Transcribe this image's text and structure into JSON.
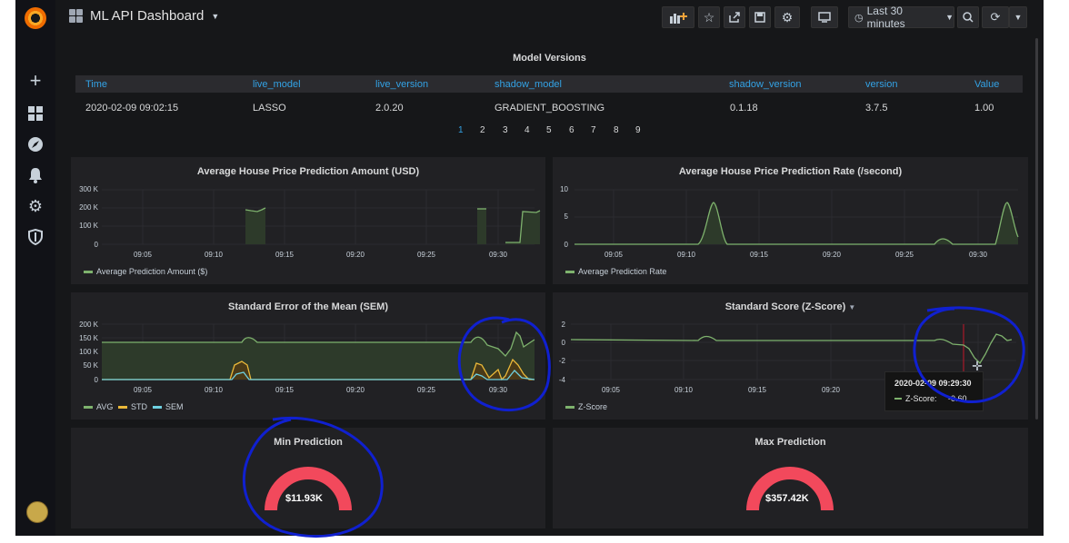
{
  "dashboard": {
    "title": "ML API Dashboard",
    "time_range": "Last 30 minutes"
  },
  "model_versions": {
    "title": "Model Versions",
    "columns": [
      "Time",
      "live_model",
      "live_version",
      "shadow_model",
      "shadow_version",
      "version",
      "Value"
    ],
    "rows": [
      [
        "2020-02-09 09:02:15",
        "LASSO",
        "2.0.20",
        "GRADIENT_BOOSTING",
        "0.1.18",
        "3.7.5",
        "1.00"
      ]
    ],
    "pages": [
      "1",
      "2",
      "3",
      "4",
      "5",
      "6",
      "7",
      "8",
      "9"
    ],
    "active_page": "1"
  },
  "x_ticks": [
    "09:05",
    "09:10",
    "09:15",
    "09:20",
    "09:25",
    "09:30"
  ],
  "chart_data": [
    {
      "type": "area",
      "title": "Average House Price Prediction Amount (USD)",
      "yticks": [
        "300 K",
        "200 K",
        "100 K",
        "0"
      ],
      "ylim": [
        0,
        300000
      ],
      "series": [
        {
          "name": "Average Prediction Amount ($)",
          "color": "#7eb26d",
          "points": [
            [
              "09:10",
              185000
            ],
            [
              "09:10:30",
              182000
            ],
            [
              "09:11",
              178000
            ],
            [
              "09:11:30",
              190000
            ],
            [
              "09:27:30",
              190000
            ],
            [
              "09:28",
              188000
            ],
            [
              "09:30",
              180000
            ],
            [
              "09:31",
              183000
            ],
            [
              "09:32",
              175000
            ],
            [
              "09:32:30",
              185000
            ]
          ]
        }
      ]
    },
    {
      "type": "area",
      "title": "Average House Price Prediction Rate (/second)",
      "yticks": [
        "10",
        "5",
        "0"
      ],
      "ylim": [
        0,
        10
      ],
      "series": [
        {
          "name": "Average Prediction Rate",
          "color": "#7eb26d",
          "points": [
            [
              "09:10",
              0
            ],
            [
              "09:11",
              3
            ],
            [
              "09:11:40",
              7.5
            ],
            [
              "09:12:30",
              2
            ],
            [
              "09:13",
              0
            ],
            [
              "09:27",
              0
            ],
            [
              "09:27:40",
              1.2
            ],
            [
              "09:28",
              1
            ],
            [
              "09:29",
              0
            ],
            [
              "09:31",
              2
            ],
            [
              "09:32",
              7.5
            ],
            [
              "09:33",
              1
            ]
          ]
        }
      ]
    },
    {
      "type": "area",
      "title": "Standard Error of the Mean (SEM)",
      "yticks": [
        "200 K",
        "150 K",
        "100 K",
        "50 K",
        "0"
      ],
      "ylim": [
        0,
        200000
      ],
      "series": [
        {
          "name": "AVG",
          "color": "#7eb26d"
        },
        {
          "name": "STD",
          "color": "#eab839"
        },
        {
          "name": "SEM",
          "color": "#6ed0e0"
        }
      ]
    },
    {
      "type": "line",
      "title": "Standard Score (Z-Score)",
      "yticks": [
        "2",
        "0",
        "-2",
        "-4"
      ],
      "ylim": [
        -4,
        2
      ],
      "series": [
        {
          "name": "Z-Score",
          "color": "#7eb26d"
        }
      ]
    }
  ],
  "tooltip": {
    "time": "2020-02-09 09:29:30",
    "label": "Z-Score:",
    "value": "-0.60"
  },
  "gauges": [
    {
      "title": "Min Prediction",
      "value": "$11.93K",
      "color": "#f2495c"
    },
    {
      "title": "Max Prediction",
      "value": "$357.42K",
      "color": "#f2495c"
    }
  ],
  "toolbar_icons": [
    "add-panel-icon",
    "star-icon",
    "share-icon",
    "save-icon",
    "settings-icon",
    "tv-mode-icon",
    "clock-icon",
    "zoom-out-icon",
    "refresh-icon",
    "chevron-down-icon"
  ],
  "sidebar_icons": [
    "grafana-logo",
    "plus-icon",
    "dashboards-icon",
    "explore-icon",
    "alerting-icon",
    "configuration-icon",
    "shield-icon",
    "user-avatar"
  ]
}
